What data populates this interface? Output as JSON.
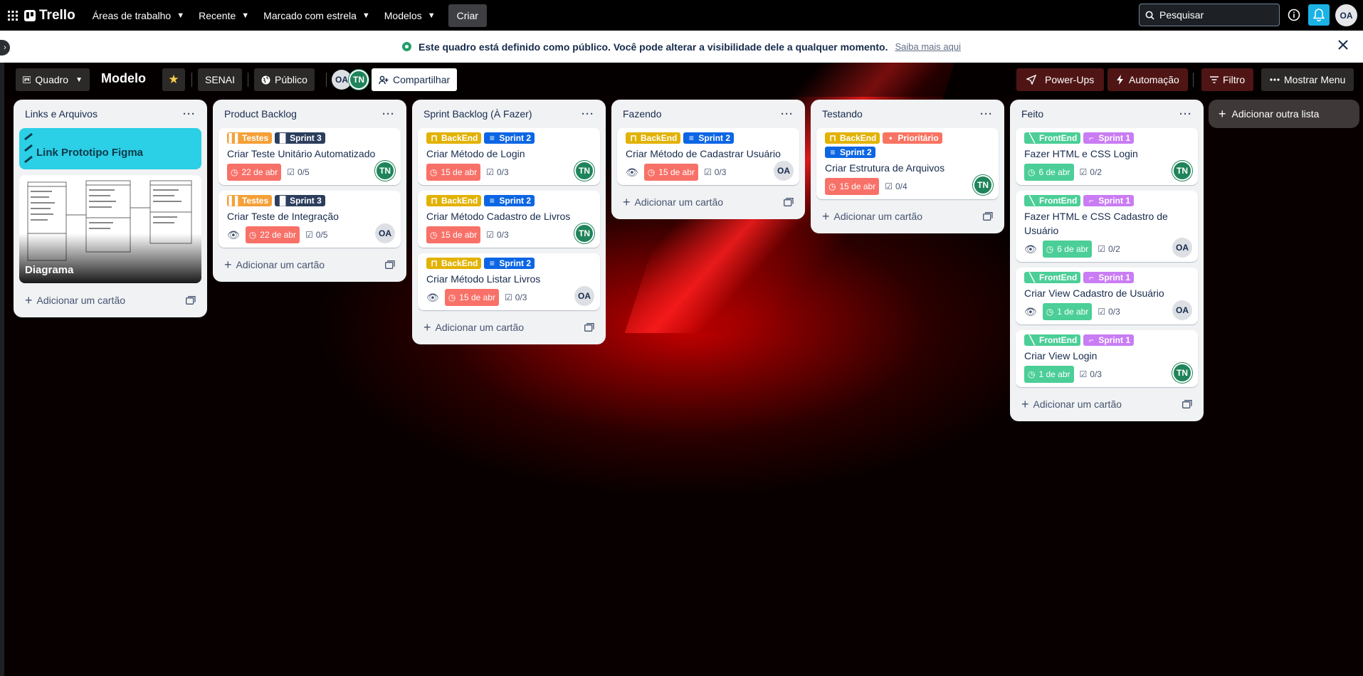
{
  "topbar": {
    "brand": "Trello",
    "nav": [
      "Áreas de trabalho",
      "Recente",
      "Marcado com estrela",
      "Modelos"
    ],
    "create": "Criar",
    "search_placeholder": "Pesquisar",
    "user": "OA"
  },
  "banner": {
    "text": "Este quadro está definido como público. Você pode alterar a visibilidade dele a qualquer momento.",
    "link": "Saiba mais aqui"
  },
  "board": {
    "view": "Quadro",
    "title": "Modelo",
    "workspace": "SENAI",
    "visibility": "Público",
    "members": [
      "OA",
      "TN"
    ],
    "share": "Compartilhar",
    "powerups": "Power-Ups",
    "automation": "Automação",
    "filter": "Filtro",
    "menu": "Mostrar Menu",
    "add_list": "Adicionar outra lista",
    "add_card": "Adicionar um cartão"
  },
  "colors": {
    "testes": "#f5a038",
    "sprint3": "#2c3e5d",
    "backend": "#e2b203",
    "sprint2": "#0c66e4",
    "frontend": "#4bce97",
    "sprint1": "#c97cf4",
    "prioritario": "#f87462",
    "due_red": "#f87168",
    "due_green": "#4bce97"
  },
  "lists": [
    {
      "title": "Links e Arquivos",
      "figma": "Link Prototipo Figma",
      "diagram": "Diagrama"
    },
    {
      "title": "Product Backlog",
      "cards": [
        {
          "l1": "Testes",
          "l2": "Sprint 3",
          "title": "Criar Teste Unitário Automatizado",
          "due": "22 de abr",
          "check": "0/5",
          "member": "TN"
        },
        {
          "l1": "Testes",
          "l2": "Sprint 3",
          "title": "Criar Teste de Integração",
          "due": "22 de abr",
          "check": "0/5",
          "member": "OA"
        }
      ]
    },
    {
      "title": "Sprint Backlog (À Fazer)",
      "cards": [
        {
          "l1": "BackEnd",
          "l2": "Sprint 2",
          "title": "Criar Método de Login",
          "due": "15 de abr",
          "check": "0/3",
          "member": "TN"
        },
        {
          "l1": "BackEnd",
          "l2": "Sprint 2",
          "title": "Criar Método Cadastro de Livros",
          "due": "15 de abr",
          "check": "0/3",
          "member": "TN"
        },
        {
          "l1": "BackEnd",
          "l2": "Sprint 2",
          "title": "Criar Método Listar Livros",
          "due": "15 de abr",
          "check": "0/3",
          "member": "OA"
        }
      ]
    },
    {
      "title": "Fazendo",
      "cards": [
        {
          "l1": "BackEnd",
          "l2": "Sprint 2",
          "title": "Criar Método de Cadastrar Usuário",
          "due": "15 de abr",
          "check": "0/3",
          "member": "OA"
        }
      ]
    },
    {
      "title": "Testando",
      "cards": [
        {
          "l1": "BackEnd",
          "l2": "Prioritário",
          "l3": "Sprint 2",
          "title": "Criar Estrutura de Arquivos",
          "due": "15 de abr",
          "check": "0/4",
          "member": "TN"
        }
      ]
    },
    {
      "title": "Feito",
      "cards": [
        {
          "l1": "FrontEnd",
          "l2": "Sprint 1",
          "title": "Fazer HTML e CSS Login",
          "due": "6 de abr",
          "check": "0/2",
          "member": "TN"
        },
        {
          "l1": "FrontEnd",
          "l2": "Sprint 1",
          "title": "Fazer HTML e CSS Cadastro de Usuário",
          "due": "6 de abr",
          "check": "0/2",
          "member": "OA"
        },
        {
          "l1": "FrontEnd",
          "l2": "Sprint 1",
          "title": "Criar View Cadastro de Usuário",
          "due": "1 de abr",
          "check": "0/3",
          "member": "OA"
        },
        {
          "l1": "FrontEnd",
          "l2": "Sprint 1",
          "title": "Criar View Login",
          "due": "1 de abr",
          "check": "0/3",
          "member": "TN"
        }
      ]
    }
  ]
}
